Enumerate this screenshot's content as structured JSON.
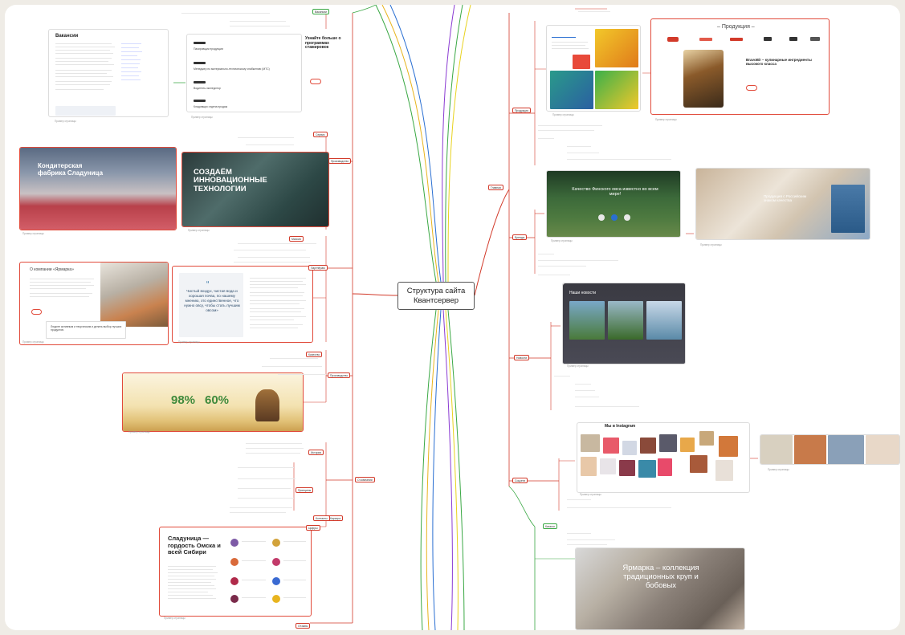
{
  "center_title": "Структура сайта Квантсервер",
  "left": {
    "vacancies": {
      "title": "Вакансии",
      "promo": "Узнайте больше о программах стажировок",
      "rows": [
        "Пакировщик продукции",
        "Менеджер по материально-техническому снабжению (МТС)",
        "Водитель-экспедитор",
        "Кладовщик отдела продаж"
      ],
      "caption": "Пример страницы"
    },
    "factory": {
      "title": "Кондитерская фабрика Сладуница",
      "caption": "Пример страницы"
    },
    "innovation": {
      "title": "СОЗДАЁМ ИННОВАЦИОННЫЕ ТЕХНОЛОГИИ",
      "caption": "Пример страницы"
    },
    "about_yarmarka": {
      "title": "О компании «Ярмарка»",
      "note": "Людите активным и творческим и делать выбор лучших продуктов.",
      "caption": "Пример страницы"
    },
    "quote": {
      "text": "Чистый воздух, чистая вода и хорошая почва, по нашему мнению, это единственное, что нужно овсу, чтобы стать лучшим овсом»",
      "caption": "Пример страницы"
    },
    "stats": {
      "value1": "98%",
      "value2": "60%",
      "caption": "Пример страницы"
    },
    "sladunitsa": {
      "title": "Сладуница — гордость Омска и всей Сибири",
      "caption": "Пример страницы"
    },
    "labels": {
      "production": "Производство",
      "about_company": "О компании",
      "for_partners": "Партнёрам",
      "production2": "Производство",
      "history": "История",
      "career": "Карьера",
      "service": "Сервис",
      "mission": "Миссия",
      "contacts": "Контакты",
      "principles": "Принципы",
      "quality": "Качество",
      "numbers": "Цифры",
      "reviews": "Отзывы",
      "vacancies_tag": "Вакансии"
    }
  },
  "right": {
    "products": {
      "title": "– Продукция –",
      "brand_line": "BravoBi! – кулинарные ингредиенты высокого класса",
      "caption": "Пример страницы"
    },
    "quality": {
      "title": "Качество Финского овса известно во всем мире!",
      "caption": "Пример страницы"
    },
    "product_card": {
      "title": "Продукция с Российским знаком качества",
      "caption": "Пример страницы"
    },
    "news": {
      "title": "Наши новости",
      "caption": "Пример страницы"
    },
    "instagram": {
      "title": "Мы в Instagram",
      "caption": "Пример страницы"
    },
    "yarmarka": {
      "title": "Ярмарка – коллекция традиционных круп и бобовых",
      "caption": "Пример страницы"
    },
    "labels": {
      "main": "Главная",
      "products": "Продукция",
      "brands": "Бренды",
      "news": "Новости",
      "social": "Соцсети",
      "catalog": "Каталог"
    }
  },
  "colors": {
    "red": "#d23a2a",
    "green": "#3aa844",
    "orange": "#f2a33a",
    "blue": "#2a6fd2",
    "purple": "#8a3ad2",
    "yellow": "#e8d21e"
  }
}
